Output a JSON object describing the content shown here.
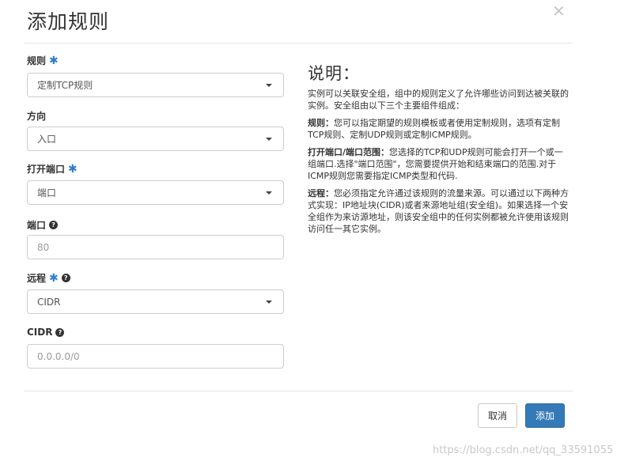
{
  "dialog": {
    "title": "添加规则",
    "close_symbol": "✕"
  },
  "form": {
    "rule": {
      "label": "规则",
      "required_mark": "✱",
      "value": "定制TCP规则"
    },
    "direction": {
      "label": "方向",
      "value": "入口"
    },
    "open_port": {
      "label": "打开端口",
      "required_mark": "✱",
      "value": "端口"
    },
    "port": {
      "label": "端口",
      "help_icon": "?",
      "placeholder": "80"
    },
    "remote": {
      "label": "远程",
      "required_mark": "✱",
      "help_icon": "?",
      "value": "CIDR"
    },
    "cidr": {
      "label": "CIDR",
      "help_icon": "?",
      "placeholder": "0.0.0.0/0"
    }
  },
  "description": {
    "heading": "说明：",
    "intro": "实例可以关联安全组，组中的规则定义了允许哪些访问到达被关联的实例。安全组由以下三个主要组件组成：",
    "rule_term": "规则：",
    "rule_text": "您可以指定期望的规则模板或者使用定制规则，选项有定制TCP规则、定制UDP规则或定制ICMP规则。",
    "port_term": "打开端口/端口范围：",
    "port_text": "您选择的TCP和UDP规则可能会打开一个或一组端口.选择\"端口范围\"，您需要提供开始和结束端口的范围.对于ICMP规则您需要指定ICMP类型和代码.",
    "remote_term": "远程：",
    "remote_text": "您必须指定允许通过该规则的流量来源。可以通过以下两种方式实现：IP地址块(CIDR)或者来源地址组(安全组)。如果选择一个安全组作为来访源地址，则该安全组中的任何实例都被允许使用该规则访问任一其它实例。"
  },
  "buttons": {
    "cancel": "取消",
    "add": "添加"
  },
  "watermark": "https://blog.csdn.net/qq_33591055",
  "colors": {
    "primary": "#337ab7",
    "required": "#2e7ecb"
  }
}
